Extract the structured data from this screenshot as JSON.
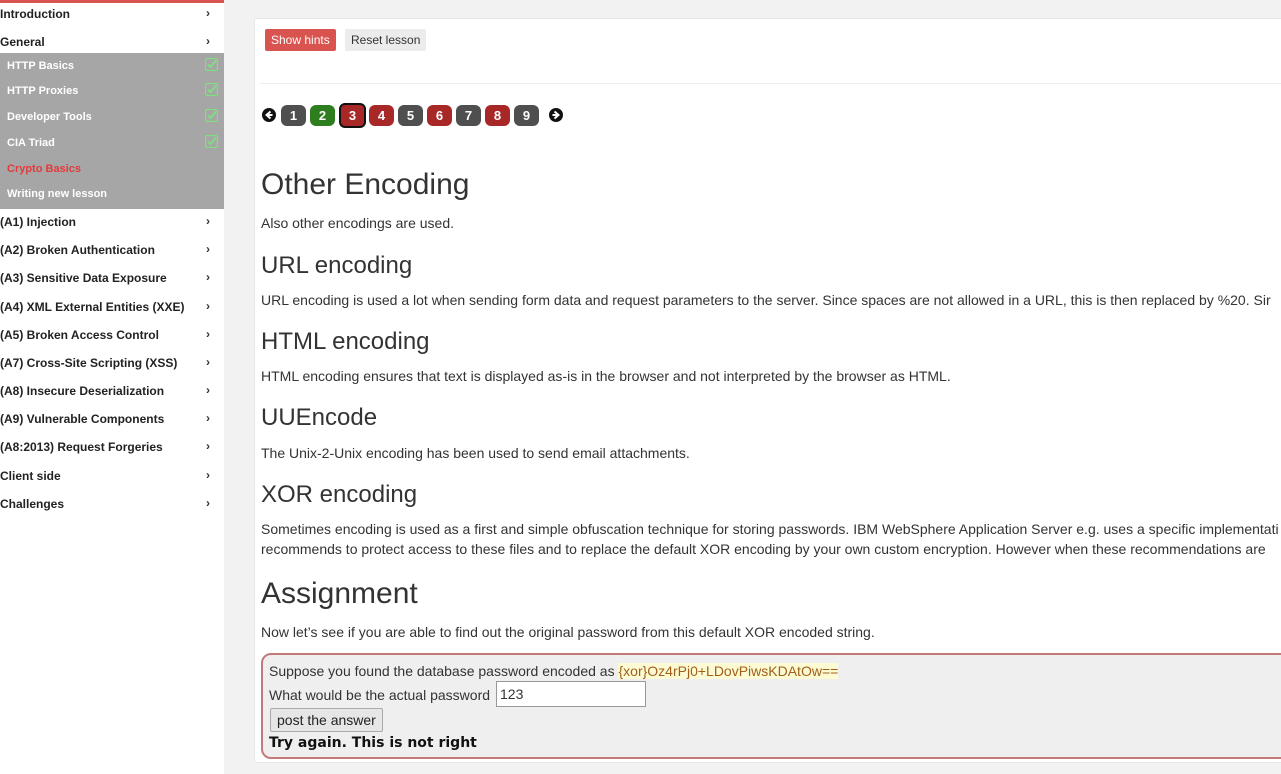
{
  "sidebar": {
    "accent_color": "#d9534f",
    "sub_bg": "#a6a6a6",
    "categories": [
      {
        "label": "Introduction",
        "expanded": false
      },
      {
        "label": "General",
        "expanded": true
      }
    ],
    "general_items": [
      {
        "label": "HTTP Basics",
        "completed": true
      },
      {
        "label": "HTTP Proxies",
        "completed": true
      },
      {
        "label": "Developer Tools",
        "completed": true
      },
      {
        "label": "CIA Triad",
        "completed": true
      },
      {
        "label": "Crypto Basics",
        "completed": false,
        "active": true
      },
      {
        "label": "Writing new lesson",
        "completed": false
      }
    ],
    "more_categories": [
      "(A1) Injection",
      "(A2) Broken Authentication",
      "(A3) Sensitive Data Exposure",
      "(A4) XML External Entities (XXE)",
      "(A5) Broken Access Control",
      "(A7) Cross-Site Scripting (XSS)",
      "(A8) Insecure Deserialization",
      "(A9) Vulnerable Components",
      "(A8:2013) Request Forgeries",
      "Client side",
      "Challenges"
    ],
    "chevron": "›"
  },
  "toolbar": {
    "show_hints": "Show hints",
    "reset_lesson": "Reset lesson"
  },
  "pager": {
    "pages": [
      {
        "label": "1",
        "state": "neutral"
      },
      {
        "label": "2",
        "state": "solved"
      },
      {
        "label": "3",
        "state": "unsolved",
        "current": true
      },
      {
        "label": "4",
        "state": "unsolved"
      },
      {
        "label": "5",
        "state": "neutral"
      },
      {
        "label": "6",
        "state": "unsolved"
      },
      {
        "label": "7",
        "state": "neutral"
      },
      {
        "label": "8",
        "state": "unsolved"
      },
      {
        "label": "9",
        "state": "neutral"
      }
    ],
    "colors": {
      "neutral": "#4f4f4f",
      "solved": "#2e7d1f",
      "unsolved": "#a82828"
    }
  },
  "content": {
    "title": "Other Encoding",
    "intro": "Also other encodings are used.",
    "sections": [
      {
        "heading": "URL encoding",
        "text": "URL encoding is used a lot when sending form data and request parameters to the server. Since spaces are not allowed in a URL, this is then replaced by %20. Sir"
      },
      {
        "heading": "HTML encoding",
        "text": "HTML encoding ensures that text is displayed as-is in the browser and not interpreted by the browser as HTML."
      },
      {
        "heading": "UUEncode",
        "text": "The Unix-2-Unix encoding has been used to send email attachments."
      },
      {
        "heading": "XOR encoding",
        "text": "Sometimes encoding is used as a first and simple obfuscation technique for storing passwords. IBM WebSphere Application Server e.g. uses a specific implementati",
        "text2": "recommends to protect access to these files and to replace the default XOR encoding by your own custom encryption. However when these recommendations are"
      }
    ],
    "assignment_title": "Assignment",
    "assignment_text": "Now let’s see if you are able to find out the original password from this default XOR encoded string."
  },
  "assignment": {
    "prompt_prefix": "Suppose you found the database password encoded as ",
    "encoded_value": "{xor}Oz4rPj0+LDovPiwsKDAtOw==",
    "question": "What would be the actual password",
    "answer_value": "123",
    "submit_label": "post the answer",
    "feedback": "Try again. This is not right"
  }
}
